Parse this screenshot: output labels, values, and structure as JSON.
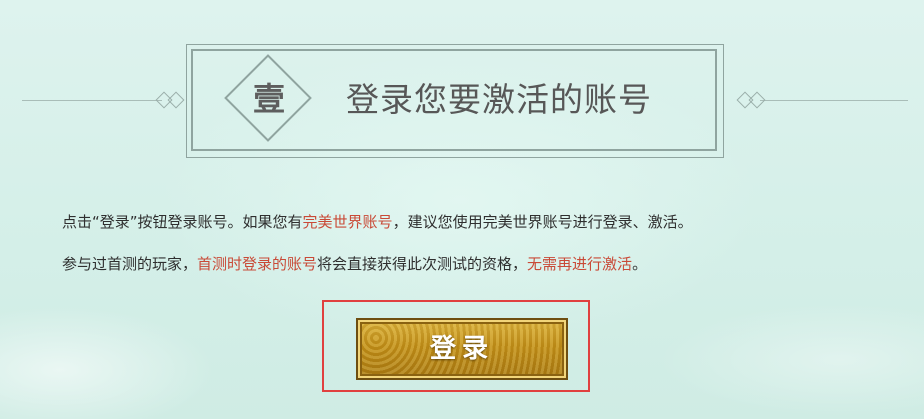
{
  "header": {
    "step_char": "壹",
    "title": "登录您要激活的账号"
  },
  "instructions": {
    "line1": {
      "part1": "点击“登录”按钮登录账号。如果您有",
      "highlight": "完美世界账号",
      "part2": "，建议您使用完美世界账号进行登录、激活。"
    },
    "line2": {
      "part1": "参与过首测的玩家，",
      "highlight1": "首测时登录的账号",
      "part2": "将会直接获得此次测试的资格，",
      "highlight2": "无需再进行激活",
      "part3": "。"
    }
  },
  "login_button": {
    "label": "登录"
  },
  "colors": {
    "highlight_text": "#c94a37",
    "button_gold": "#c28f17",
    "selection_border": "#e0403f",
    "background": "#d8f0ea"
  }
}
